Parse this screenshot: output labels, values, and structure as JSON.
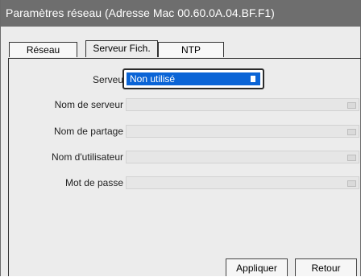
{
  "window": {
    "title": "Paramètres réseau (Adresse Mac 00.60.0A.04.BF.F1)"
  },
  "tabs": [
    {
      "label": "Réseau",
      "active": false
    },
    {
      "label": "Serveur Fich.",
      "active": true
    },
    {
      "label": "NTP",
      "active": false
    }
  ],
  "form": {
    "server_type": {
      "label": "Serveu",
      "value": "Non utilisé"
    },
    "server_name": {
      "label": "Nom de serveur",
      "value": ""
    },
    "share_name": {
      "label": "Nom de partage",
      "value": ""
    },
    "username": {
      "label": "Nom d'utilisateur",
      "value": ""
    },
    "password": {
      "label": "Mot de passe",
      "value": ""
    }
  },
  "buttons": {
    "apply": "Appliquer",
    "back": "Retour"
  },
  "colors": {
    "titlebar": "#6e6e6e",
    "select_accent": "#0a64d6",
    "background": "#ececec"
  }
}
